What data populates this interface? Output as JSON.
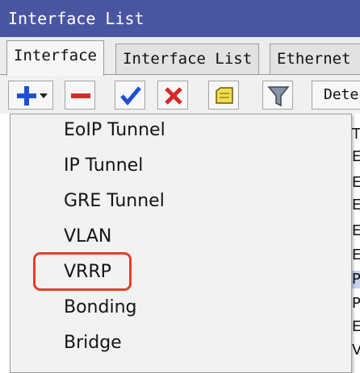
{
  "window": {
    "title": "Interface List"
  },
  "tabs": [
    {
      "label": "Interface",
      "active": true
    },
    {
      "label": "Interface List",
      "active": false
    },
    {
      "label": "Ethernet",
      "active": false
    }
  ],
  "toolbar": {
    "buttons": [
      {
        "icon": "add-dropdown-icon"
      },
      {
        "icon": "remove-icon"
      },
      {
        "icon": "enable-checkmark-icon"
      },
      {
        "icon": "disable-x-icon"
      },
      {
        "icon": "comment-icon"
      },
      {
        "icon": "filter-icon"
      }
    ],
    "detect_label": "Dete"
  },
  "menu": {
    "items": [
      {
        "label": "EoIP Tunnel"
      },
      {
        "label": "IP Tunnel"
      },
      {
        "label": "GRE Tunnel"
      },
      {
        "label": "VLAN"
      },
      {
        "label": "VRRP",
        "highlighted": true
      },
      {
        "label": "Bonding"
      },
      {
        "label": "Bridge"
      }
    ]
  },
  "background_rows": [
    "T",
    "E",
    "E",
    "E",
    "E",
    "E",
    "P",
    "P",
    "E",
    "V"
  ],
  "colors": {
    "titlebar": "#4a55a2",
    "highlight": "#e63e2c",
    "plus": "#1f4fd6",
    "minus": "#d42a2a"
  }
}
